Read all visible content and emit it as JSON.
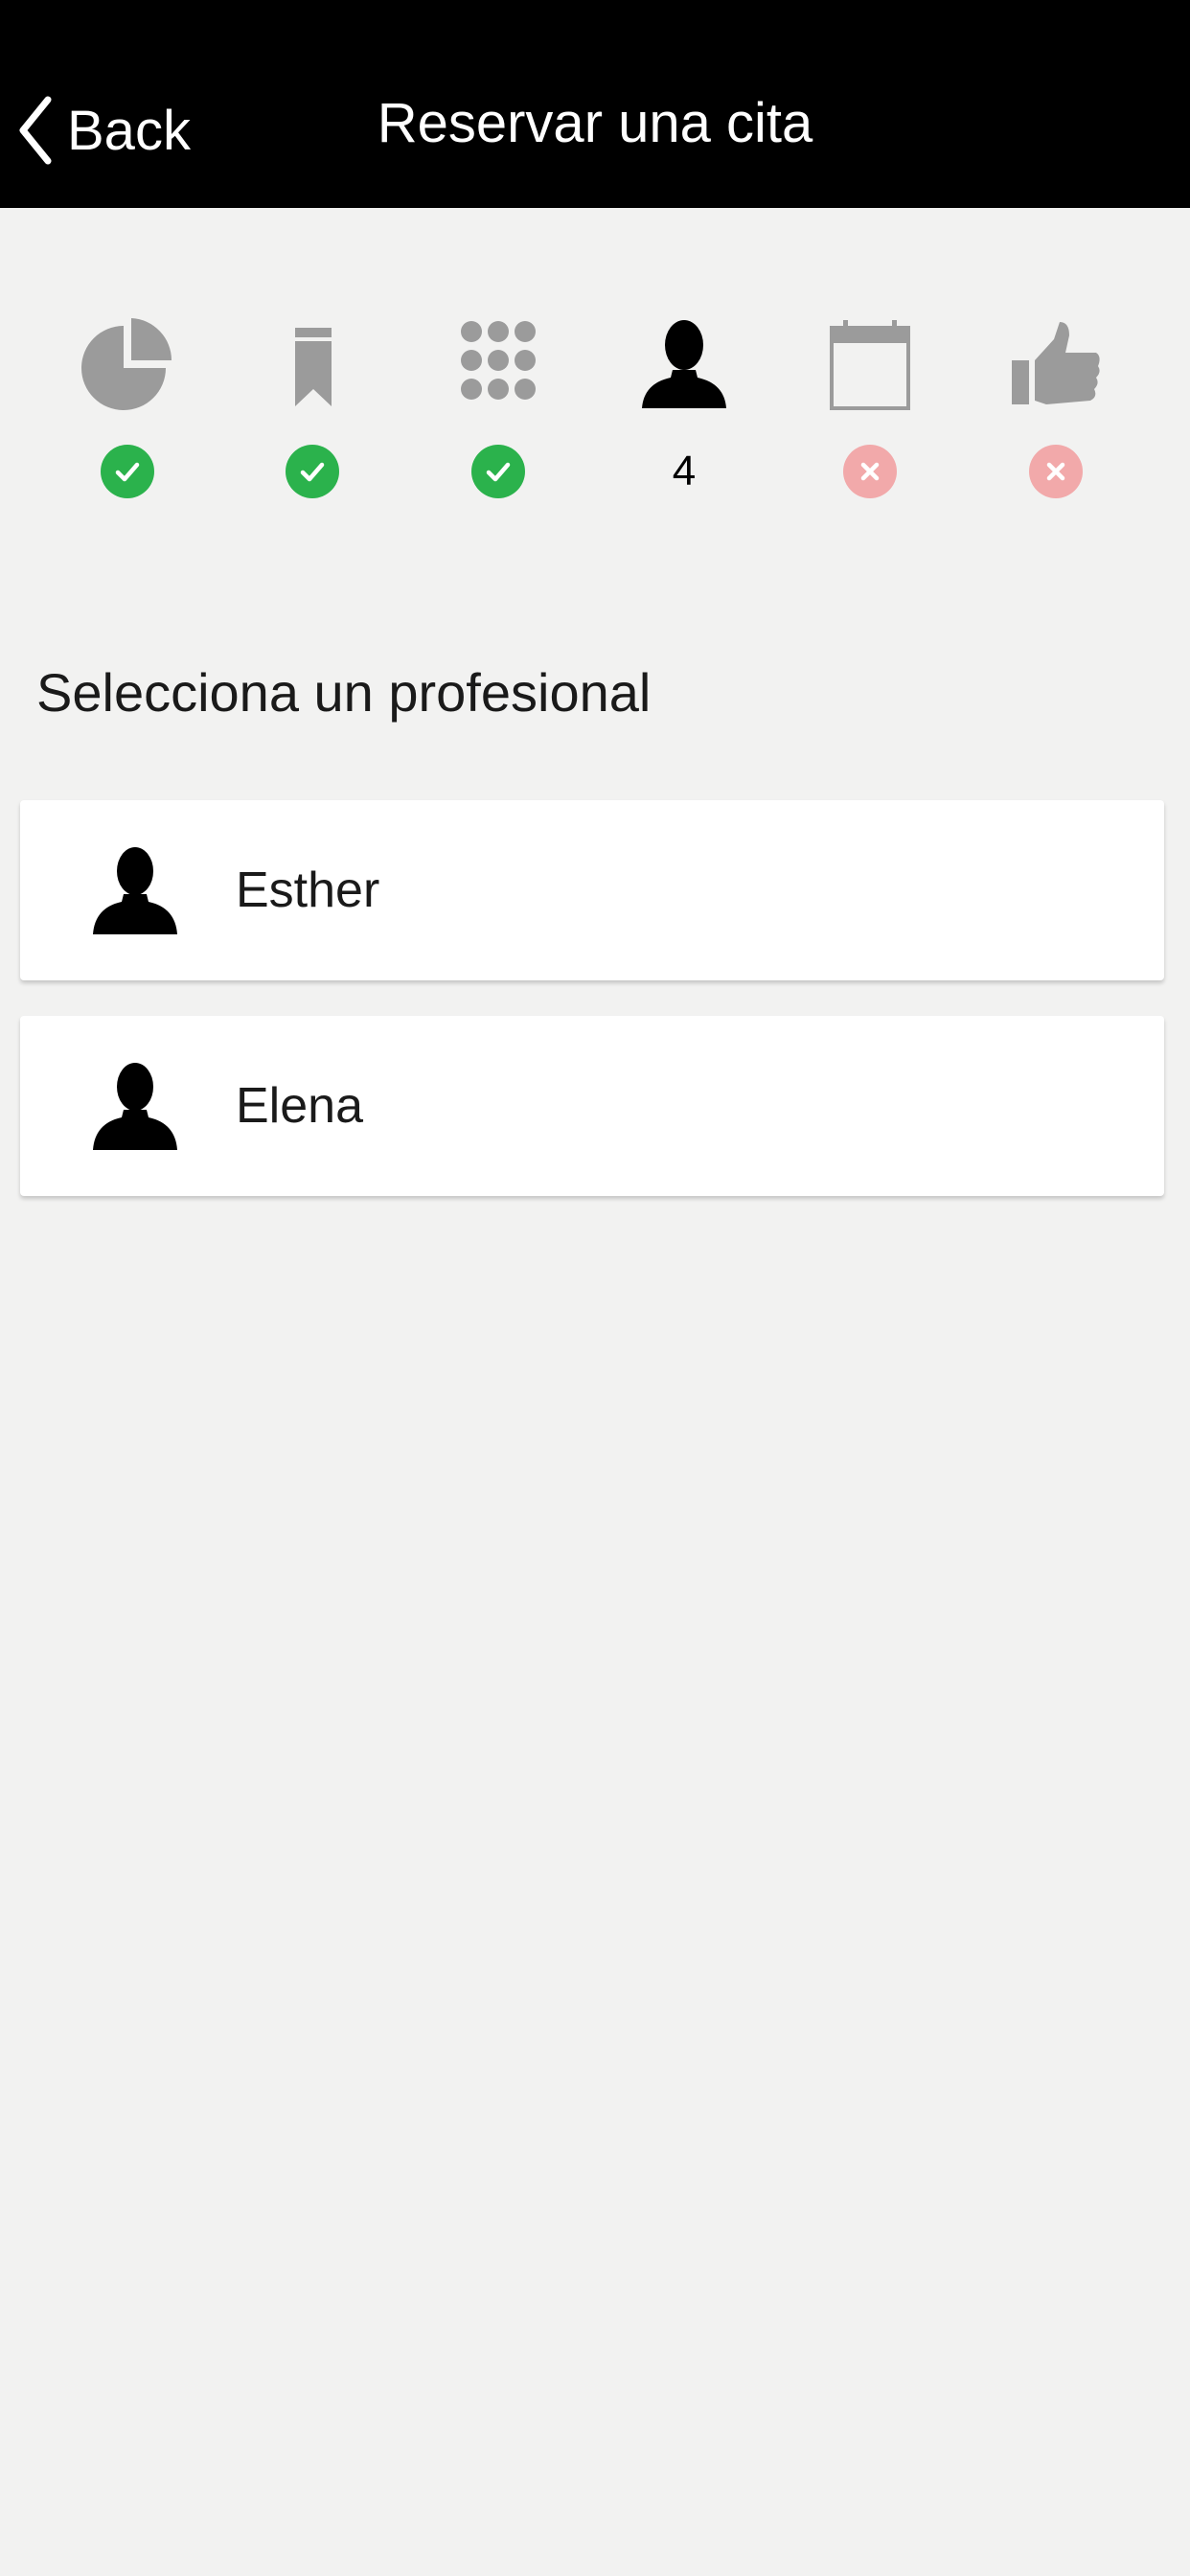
{
  "nav": {
    "back_label": "Back",
    "title": "Reservar una cita"
  },
  "steps": [
    {
      "icon": "pie-chart-icon",
      "status": "done"
    },
    {
      "icon": "bookmark-icon",
      "status": "done"
    },
    {
      "icon": "grid-icon",
      "status": "done"
    },
    {
      "icon": "person-icon",
      "status": "current",
      "number": "4"
    },
    {
      "icon": "calendar-icon",
      "status": "pending"
    },
    {
      "icon": "thumbs-up-icon",
      "status": "pending"
    }
  ],
  "colors": {
    "nav_bg": "#000000",
    "done": "#2bb24c",
    "pending": "#f2a9aa",
    "inactive_icon": "#9b9b9b",
    "active_icon": "#000000",
    "background": "#f2f2f1"
  },
  "section_title": "Selecciona un profesional",
  "professionals": [
    {
      "name": "Esther",
      "icon": "person-icon"
    },
    {
      "name": "Elena",
      "icon": "person-icon"
    }
  ]
}
